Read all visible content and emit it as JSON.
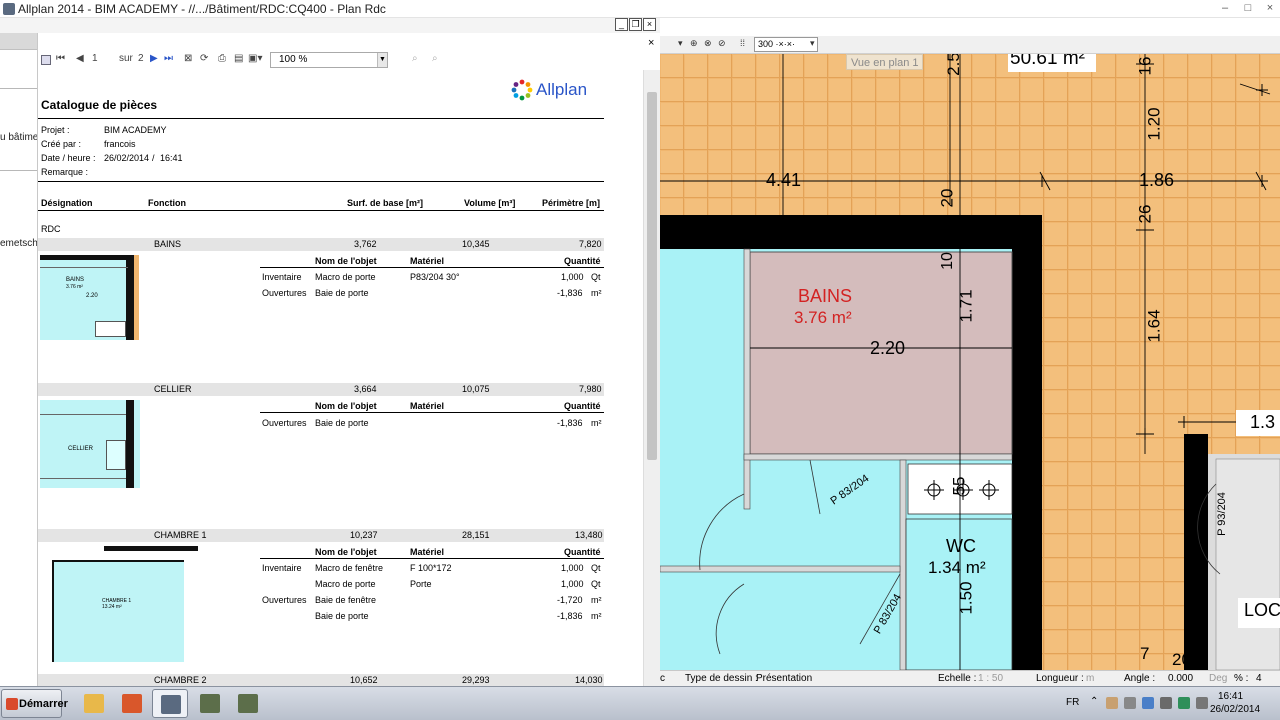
{
  "window": {
    "title": "Allplan 2014 - BIM ACADEMY - //.../Bâtiment/RDC:CQ400 - Plan Rdc",
    "minimize": "–",
    "maximize": "□",
    "close": "×"
  },
  "leftstrip": {
    "item1": "u bâtimer",
    "item2": "emetsche"
  },
  "report_window": {
    "minimize": "_",
    "restore": "❐",
    "close": "×",
    "close2": "×"
  },
  "report_toolbar": {
    "page_current": "1",
    "page_of": "sur",
    "page_total": "2",
    "zoom": "100 %"
  },
  "report": {
    "logo_text": "Allplan",
    "title": "Catalogue de pièces",
    "meta": {
      "projet_label": "Projet :",
      "projet_value": "BIM ACADEMY",
      "cree_label": "Créé par :",
      "cree_value": "francois",
      "date_label": "Date / heure :",
      "date_value": "26/02/2014",
      "time_sep": "/",
      "time_value": "16:41",
      "remarque_label": "Remarque :"
    },
    "headers": {
      "designation": "Désignation",
      "fonction": "Fonction",
      "surface": "Surf. de base [m²]",
      "volume": "Volume [m³]",
      "perimetre": "Périmètre [m]"
    },
    "level": "RDC",
    "sub_headers": {
      "nom": "Nom de l'objet",
      "materiel": "Matériel",
      "quantite": "Quantité"
    },
    "rooms": [
      {
        "name": "BAINS",
        "surface": "3,762",
        "volume": "10,345",
        "perimetre": "7,820",
        "thumb_name": "BAINS",
        "thumb_area": "3.76 m²",
        "thumb_dim": "2.20",
        "items": [
          {
            "group": "Inventaire",
            "nom": "Macro de porte",
            "materiel": "P83/204 30°",
            "qty": "1,000",
            "unit": "Qt"
          },
          {
            "group": "Ouvertures",
            "nom": "Baie de porte",
            "materiel": "",
            "qty": "-1,836",
            "unit": "m²"
          }
        ]
      },
      {
        "name": "CELLIER",
        "surface": "3,664",
        "volume": "10,075",
        "perimetre": "7,980",
        "thumb_name": "CELLIER",
        "thumb_area": "",
        "thumb_dim": "",
        "items": [
          {
            "group": "Ouvertures",
            "nom": "Baie de porte",
            "materiel": "",
            "qty": "-1,836",
            "unit": "m²"
          }
        ]
      },
      {
        "name": "CHAMBRE 1",
        "surface": "10,237",
        "volume": "28,151",
        "perimetre": "13,480",
        "thumb_name": "CHAMBRE 1",
        "thumb_area": "13.24 m²",
        "thumb_dim": "",
        "items": [
          {
            "group": "Inventaire",
            "nom": "Macro de fenêtre",
            "materiel": "F 100*172",
            "qty": "1,000",
            "unit": "Qt"
          },
          {
            "group": "",
            "nom": "Macro de porte",
            "materiel": "Porte",
            "qty": "1,000",
            "unit": "Qt"
          },
          {
            "group": "Ouvertures",
            "nom": "Baie de fenêtre",
            "materiel": "",
            "qty": "-1,720",
            "unit": "m²"
          },
          {
            "group": "",
            "nom": "Baie de porte",
            "materiel": "",
            "qty": "-1,836",
            "unit": "m²"
          }
        ]
      },
      {
        "name": "CHAMBRE 2",
        "surface": "10,652",
        "volume": "29,293",
        "perimetre": "14,030"
      }
    ]
  },
  "cad_toolbar": {
    "scale": "300 ·×·×·"
  },
  "cad": {
    "vue_label": "Vue en plan 1",
    "area_top": "50.61 m²",
    "dims": {
      "d441": "4.41",
      "d186": "1.86",
      "d120": "1.20",
      "d164": "1.64",
      "d26": "26",
      "d16": "16",
      "d20": "20",
      "d25": "2.5",
      "d10": "10",
      "d171": "1.71",
      "d220": "2.20",
      "d55": "55",
      "d150": "1.50",
      "d13": "1.3",
      "d7": "7",
      "d20b": "20"
    },
    "bains_name": "BAINS",
    "bains_area": "3.76 m²",
    "wc_name": "WC",
    "wc_area": "1.34 m²",
    "door1": "P 83/204",
    "door2": "P 83/204",
    "door3": "P 93/204",
    "loc": "LOC"
  },
  "cad_status": {
    "c": "c",
    "type_label": "Type de dessin :",
    "type_value": "Présentation",
    "echelle_label": "Echelle :",
    "echelle_value": "1 : 50",
    "longueur_label": "Longueur :",
    "longueur_value": "m",
    "angle_label": "Angle :",
    "angle_value": "0.000",
    "angle_unit": "Deg",
    "pct_label": "% :",
    "pct_value": "4"
  },
  "taskbar": {
    "start_label": "Démarrer",
    "lang": "FR",
    "time": "16:41",
    "date": "26/02/2014"
  },
  "colors": {
    "accent_red": "#d32222",
    "tile_orange": "#f0b66f",
    "room_cyan": "#a9f2f6",
    "room_pink": "#d4bcbc"
  }
}
